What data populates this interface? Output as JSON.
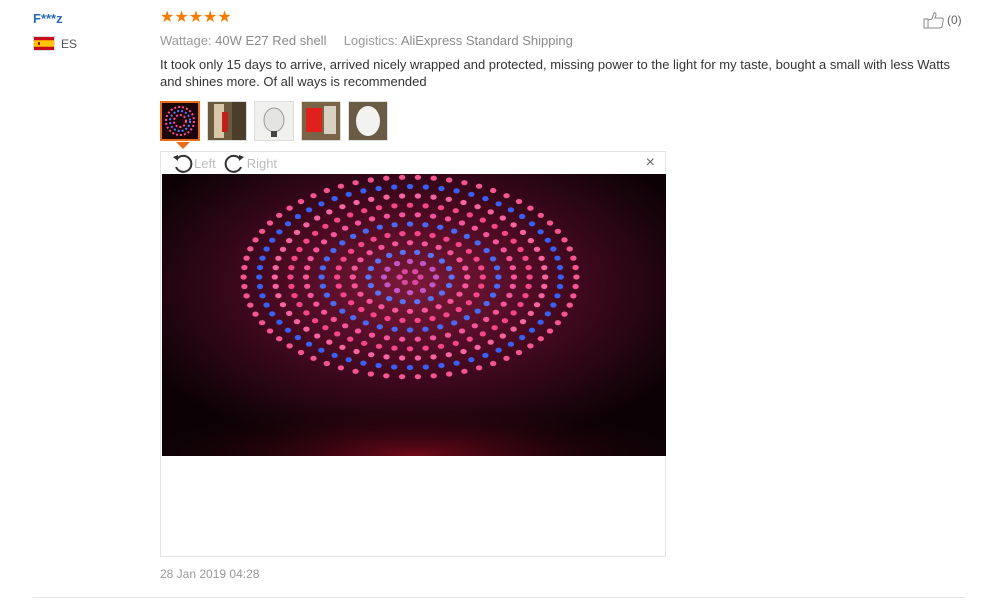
{
  "review": {
    "reviewer_name": "F***z",
    "country_code": "ES",
    "flag_colors": [
      "#c60b1e",
      "#ffc400"
    ],
    "rating": 5,
    "stars_text": "★★★★★",
    "wattage_label": "Wattage:",
    "wattage_value": "40W E27 Red shell",
    "logistics_label": "Logistics:",
    "logistics_value": "AliExpress Standard Shipping",
    "text": "It took only 15 days to arrive, arrived nicely wrapped and protected, missing power to the light for my taste, bought a small with less Watts and shines more. Of all ways is recommended",
    "helpful_count": "(0)",
    "date": "28 Jan 2019 04:28"
  },
  "gallery": {
    "thumbnail_count": 5,
    "selected_index": 0,
    "rotate_left_label": "Left",
    "rotate_right_label": "Right",
    "close_symbol": "×"
  },
  "colors": {
    "accent": "#e96c1a",
    "star": "#f57c00",
    "name": "#2b6bb8"
  }
}
